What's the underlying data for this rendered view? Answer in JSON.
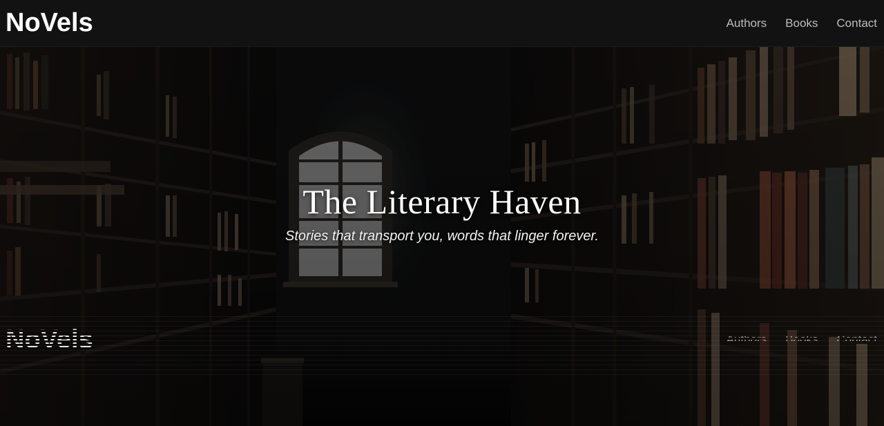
{
  "navbar": {
    "brand": "NoVels",
    "links": [
      {
        "label": "Authors"
      },
      {
        "label": "Books"
      },
      {
        "label": "Contact"
      }
    ]
  },
  "hero": {
    "title": "The Literary Haven",
    "subtitle": "Stories that transport you, words that linger forever."
  },
  "colors": {
    "navbar_bg": "#121212",
    "brand_text": "#ffffff",
    "nav_link_text": "#bdbdbd",
    "hero_text": "#ffffff"
  }
}
